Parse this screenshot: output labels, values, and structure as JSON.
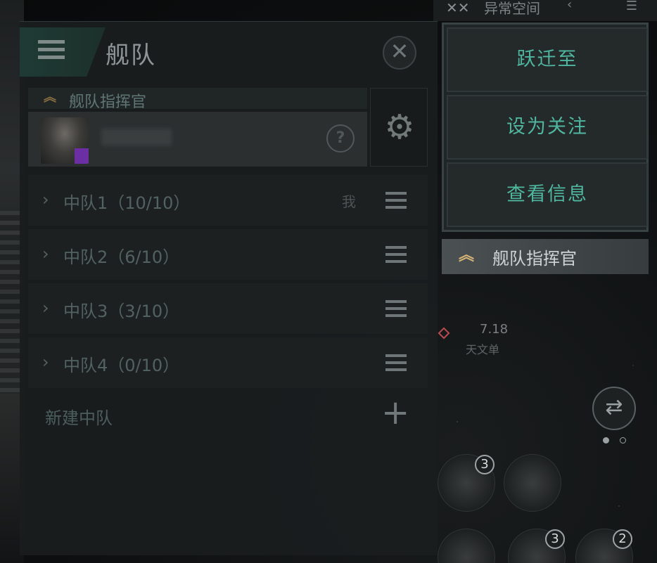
{
  "hud": {
    "title": "异常空间",
    "x_icon": "crossed-swords-icon",
    "arrow": "‹",
    "bars_icon": "list-icon"
  },
  "panel": {
    "title": "舰队",
    "commander_label": "舰队指挥官",
    "squads": [
      {
        "label": "中队1（10/10）",
        "tag": "我"
      },
      {
        "label": "中队2（6/10）",
        "tag": ""
      },
      {
        "label": "中队3（3/10）",
        "tag": ""
      },
      {
        "label": "中队4（0/10）",
        "tag": ""
      }
    ],
    "new_squad": "新建中队"
  },
  "popup": {
    "items": [
      "跃迁至",
      "设为关注",
      "查看信息"
    ],
    "role_label": "舰队指挥官"
  },
  "background": {
    "distance": "7.18",
    "unit_text": "天文单",
    "modules": [
      {
        "count": "3"
      },
      {
        "count": ""
      },
      {
        "count": ""
      },
      {
        "count": "3"
      },
      {
        "count": "2"
      }
    ]
  },
  "colors": {
    "accent": "#4fb7a0",
    "rank_gold": "#d6b577",
    "panel_bg": "#1a1d1e"
  }
}
